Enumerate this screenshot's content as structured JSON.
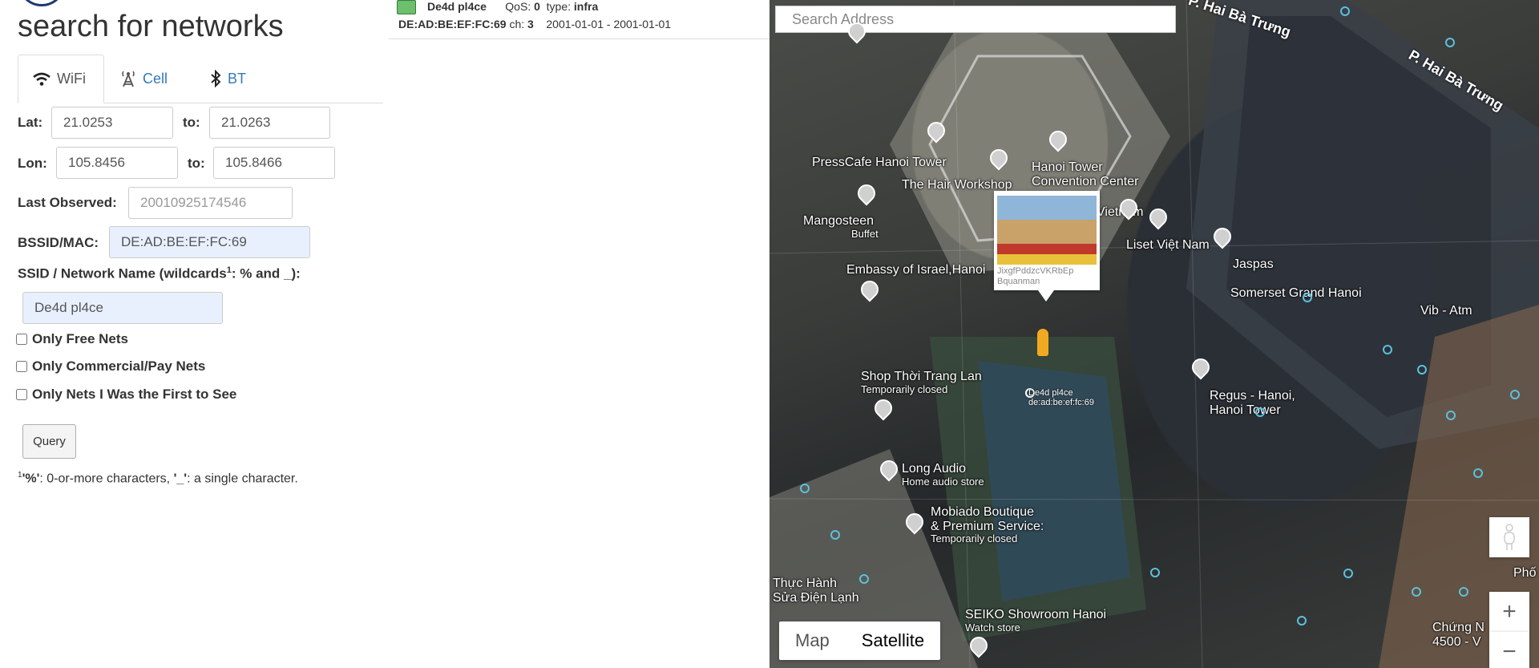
{
  "left": {
    "title": "search for networks",
    "tabs": [
      {
        "label": "WiFi",
        "icon": "wifi-icon",
        "active": true
      },
      {
        "label": "Cell",
        "icon": "cell-tower-icon",
        "active": false
      },
      {
        "label": "BT",
        "icon": "bluetooth-icon",
        "active": false
      }
    ],
    "lat_label": "Lat:",
    "lat_from": "21.0253",
    "to_label": "to:",
    "lat_to": "21.0263",
    "lon_label": "Lon:",
    "lon_from": "105.8456",
    "lon_to": "105.8466",
    "last_observed_label": "Last Observed:",
    "last_observed_placeholder": "20010925174546",
    "bssid_label": "BSSID/MAC:",
    "bssid_value": "DE:AD:BE:EF:FC:69",
    "ssid_label_pre": "SSID / Network Name (wildcards",
    "ssid_label_sup": "1",
    "ssid_label_post": ": % and _):",
    "ssid_value": "De4d pl4ce",
    "only_free": "Only Free Nets",
    "only_commercial": "Only Commercial/Pay Nets",
    "only_first": "Only Nets I Was the First to See",
    "query_button": "Query",
    "footnote_sup": "1",
    "footnote_a": "'%'",
    "footnote_b": ": 0-or-more characters, ",
    "footnote_c": "'_'",
    "footnote_d": ": a single character."
  },
  "results": {
    "ssid": "De4d pl4ce",
    "qos_label": "QoS:",
    "qos": "0",
    "type_label": "type:",
    "type": "infra",
    "bssid": "DE:AD:BE:EF:FC:69",
    "ch_label": "ch:",
    "ch": "3",
    "dates": "2001-01-01 - 2001-01-01"
  },
  "map": {
    "search_placeholder": "Search Address",
    "roads": [
      "P. Hai Bà Trưng",
      "P. Hai Bà Trưng"
    ],
    "pois": {
      "pressCafe": "PressCafe Hanoi Tower",
      "hairWorkshop": "The Hair Workshop",
      "hanoiTower": "Hanoi Tower\nConvention Center",
      "mangosteen": "Mangosteen",
      "mangosteen_sub": "Buffet",
      "vietnam": "Vietnam",
      "lisetVietNam": "Liset Việt Nam",
      "jaspas": "Jaspas",
      "embassy": "Embassy of Israel,Hanoi",
      "somerset": "Somerset Grand Hanoi",
      "vibAtm": "Vib - Atm",
      "shopThoiTrang": "Shop Thời Trang Lan",
      "shopThoiTrang_sub": "Temporarily closed",
      "regus": "Regus - Hanoi,\nHanoi Tower",
      "longAudio": "Long Audio",
      "longAudio_sub": "Home audio store",
      "mobiado": "Mobiado Boutique\n& Premium Service:",
      "mobiado_sub": "Temporarily closed",
      "thucHanh": "Thực Hành\nSửa Điện Lạnh",
      "seiko": "SEIKO Showroom Hanoi",
      "seiko_sub": "Watch store",
      "chungN": "Chứng N\n4500 - V",
      "pho": "Phố"
    },
    "infowindow_caption": "JixgfPddzcVKRbEp\nBquanman",
    "wifi_marker_label": "De4d pl4ce\nde:ad:be:ef:fc:69",
    "maptype": [
      "Map",
      "Satellite"
    ],
    "active_maptype": "Satellite"
  }
}
